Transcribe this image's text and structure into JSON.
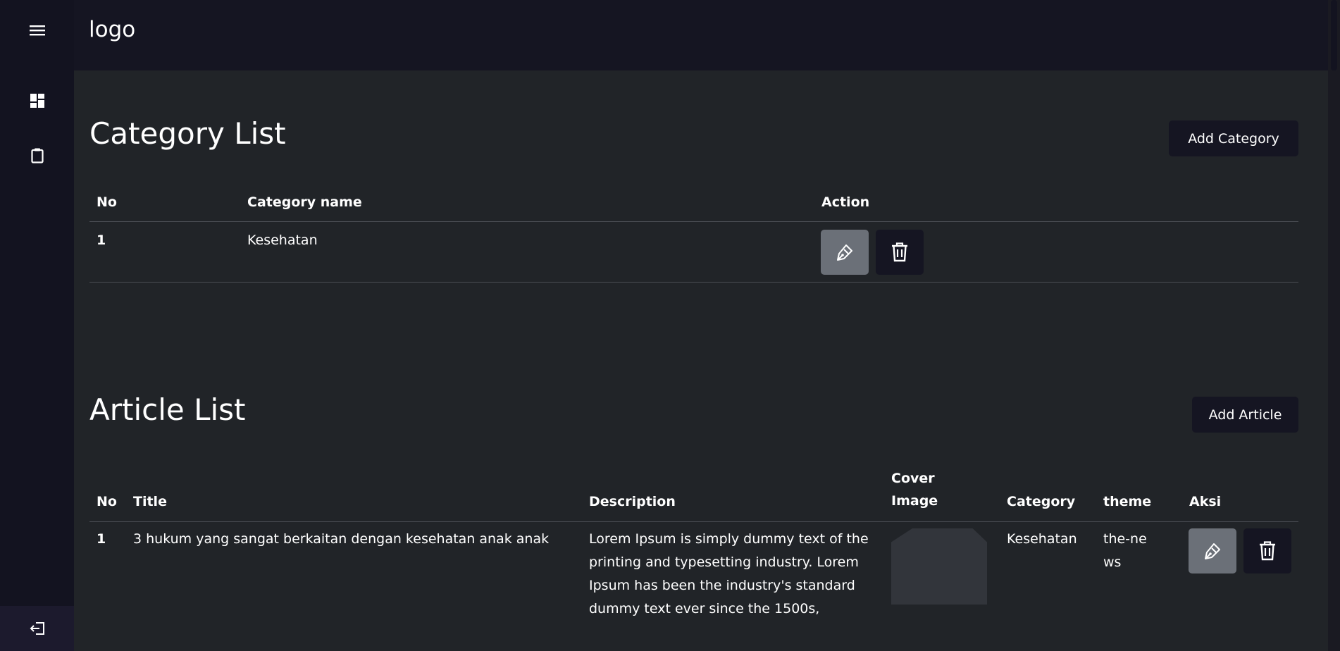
{
  "sidebar": {
    "menu_icon": "hamburger-icon",
    "items": [
      {
        "icon": "dashboard-icon"
      },
      {
        "icon": "clipboard-icon"
      }
    ],
    "logout_icon": "logout-icon"
  },
  "header": {
    "logo": "logo"
  },
  "category_section": {
    "title": "Category List",
    "add_label": "Add Category",
    "columns": [
      "No",
      "Category name",
      "Action"
    ],
    "rows": [
      {
        "no": "1",
        "name": "Kesehatan"
      }
    ]
  },
  "article_section": {
    "title": "Article List",
    "add_label": "Add Article",
    "columns": [
      "No",
      "Title",
      "Description",
      "Cover Image",
      "Category",
      "theme",
      "Aksi"
    ],
    "rows": [
      {
        "no": "1",
        "title": "3 hukum yang sangat berkaitan dengan kesehatan anak anak",
        "description": "Lorem Ipsum is simply dummy text of the printing and typesetting industry. Lorem Ipsum has been the industry's standard dummy text ever since the 1500s,",
        "category": "Kesehatan",
        "theme": "the-news"
      }
    ]
  },
  "colors": {
    "background": "#212428",
    "sidebar": "#131320",
    "topbar": "#151522",
    "edit_button": "#6b7078",
    "delete_button": "#151522"
  }
}
